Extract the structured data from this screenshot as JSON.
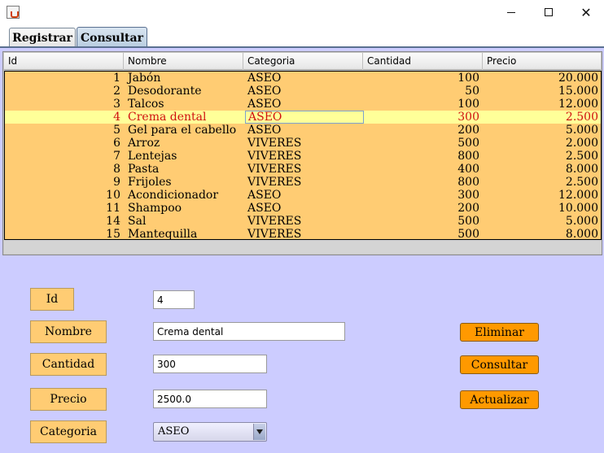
{
  "window": {
    "icon": "java-icon",
    "controls": [
      "minimize",
      "maximize",
      "close"
    ]
  },
  "tabs": [
    {
      "label": "Registrar",
      "active": false
    },
    {
      "label": "Consultar",
      "active": true
    }
  ],
  "table": {
    "columns": [
      "Id",
      "Nombre",
      "Categoria",
      "Cantidad",
      "Precio"
    ],
    "selected_id": "4",
    "rows": [
      {
        "id": "1",
        "nombre": "Jabón",
        "categoria": "ASEO",
        "cantidad": "100",
        "precio": "20.000"
      },
      {
        "id": "2",
        "nombre": "Desodorante",
        "categoria": "ASEO",
        "cantidad": "50",
        "precio": "15.000"
      },
      {
        "id": "3",
        "nombre": "Talcos",
        "categoria": "ASEO",
        "cantidad": "100",
        "precio": "12.000"
      },
      {
        "id": "4",
        "nombre": "Crema dental",
        "categoria": "ASEO",
        "cantidad": "300",
        "precio": "2.500"
      },
      {
        "id": "5",
        "nombre": "Gel para el cabello",
        "categoria": "ASEO",
        "cantidad": "200",
        "precio": "5.000"
      },
      {
        "id": "6",
        "nombre": "Arroz",
        "categoria": "VIVERES",
        "cantidad": "500",
        "precio": "2.000"
      },
      {
        "id": "7",
        "nombre": "Lentejas",
        "categoria": "VIVERES",
        "cantidad": "800",
        "precio": "2.500"
      },
      {
        "id": "8",
        "nombre": "Pasta",
        "categoria": "VIVERES",
        "cantidad": "400",
        "precio": "8.000"
      },
      {
        "id": "9",
        "nombre": "Frijoles",
        "categoria": "VIVERES",
        "cantidad": "800",
        "precio": "2.500"
      },
      {
        "id": "10",
        "nombre": "Acondicionador",
        "categoria": "ASEO",
        "cantidad": "300",
        "precio": "12.000"
      },
      {
        "id": "11",
        "nombre": "Shampoo",
        "categoria": "ASEO",
        "cantidad": "200",
        "precio": "10.000"
      },
      {
        "id": "14",
        "nombre": "Sal",
        "categoria": "VIVERES",
        "cantidad": "500",
        "precio": "5.000"
      },
      {
        "id": "15",
        "nombre": "Mantequilla",
        "categoria": "VIVERES",
        "cantidad": "500",
        "precio": "8.000"
      }
    ]
  },
  "form": {
    "id_label": "Id",
    "id_value": "4",
    "nombre_label": "Nombre",
    "nombre_value": "Crema dental",
    "cantidad_label": "Cantidad",
    "cantidad_value": "300",
    "precio_label": "Precio",
    "precio_value": "2500.0",
    "categoria_label": "Categoria",
    "categoria_value": "ASEO"
  },
  "buttons": {
    "eliminar": "Eliminar",
    "consultar": "Consultar",
    "actualizar": "Actualizar"
  },
  "colors": {
    "background": "#ccccff",
    "row": "#ffcc73",
    "selected_row": "#ffff99",
    "selected_text": "#d01010",
    "button": "#ff9900"
  }
}
